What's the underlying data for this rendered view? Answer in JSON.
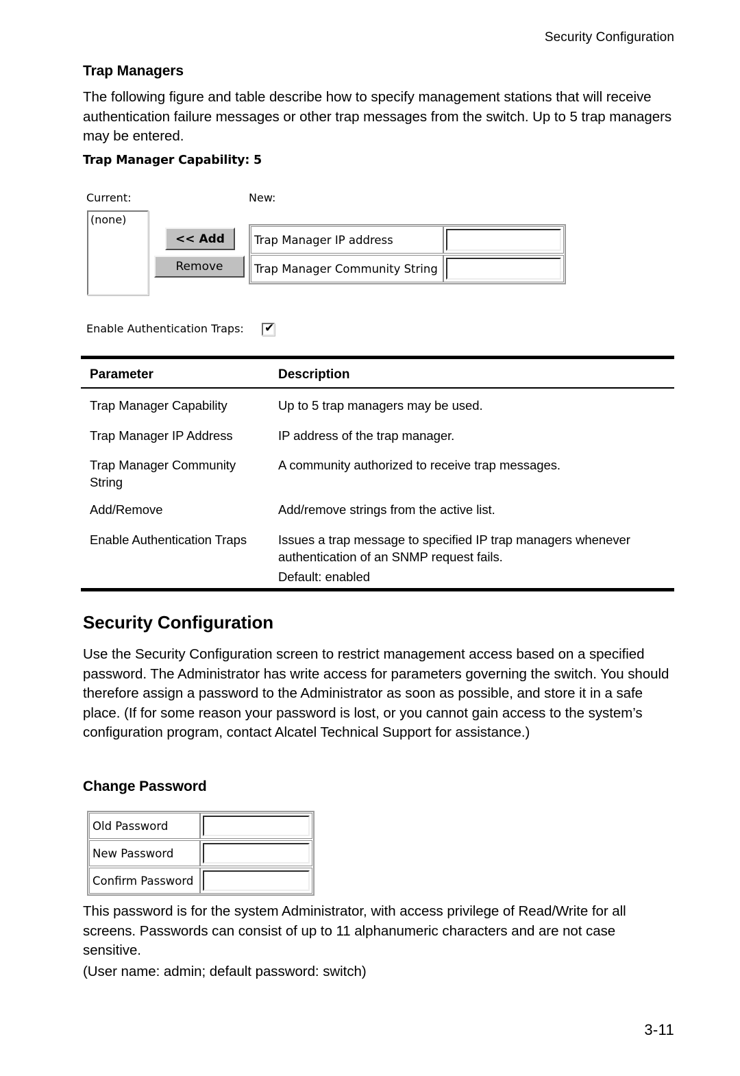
{
  "page": {
    "running_header": "Security Configuration",
    "folio": "3-11"
  },
  "trap_managers": {
    "heading": "Trap Managers",
    "intro": "The following figure and table describe how to specify management stations that will receive authentication failure messages or other trap messages from the switch. Up to 5 trap managers may be entered.",
    "screenshot": {
      "capability_line": "Trap Manager Capability: 5",
      "current_label": "Current:",
      "new_label": "New:",
      "current_list_item": "(none)",
      "add_button": "<< Add",
      "remove_button": "Remove",
      "fields": [
        {
          "label": "Trap Manager IP address",
          "value": "",
          "placeholder": ""
        },
        {
          "label": "Trap Manager Community String",
          "value": "",
          "placeholder": ""
        }
      ],
      "auth_traps_label": "Enable Authentication Traps:",
      "auth_traps_checked": true,
      "checkbox_glyph": "✔"
    },
    "table": {
      "headers": [
        "Parameter",
        "Description"
      ],
      "rows": [
        {
          "parameter": "Trap Manager Capability",
          "description": [
            "Up to 5 trap managers may be used."
          ]
        },
        {
          "parameter": "Trap Manager IP Address",
          "description": [
            "IP address of the trap manager."
          ]
        },
        {
          "parameter": "Trap Manager Community String",
          "description": [
            "A community authorized to receive trap messages."
          ]
        },
        {
          "parameter": "Add/Remove",
          "description": [
            "Add/remove strings from the active list."
          ]
        },
        {
          "parameter": "Enable Authentication Traps",
          "description": [
            "Issues a trap message to specified IP trap managers whenever authentication of an SNMP request fails.",
            "Default: enabled"
          ]
        }
      ]
    }
  },
  "security_configuration": {
    "heading": "Security Configuration",
    "intro": "Use the Security Configuration screen to restrict management access based on a specified password. The Administrator has write access for parameters governing the switch. You should therefore assign a password to the Administrator as soon as possible, and store it in a safe place. (If for some reason your password is lost, or you cannot gain access to the system’s configuration program, contact Alcatel Technical Support for assistance.)"
  },
  "change_password": {
    "heading": "Change Password",
    "fields": [
      {
        "label": "Old Password",
        "value": "",
        "placeholder": ""
      },
      {
        "label": "New Password",
        "value": "",
        "placeholder": ""
      },
      {
        "label": "Confirm Password",
        "value": "",
        "placeholder": ""
      }
    ],
    "note": "This password is for the system Administrator, with access privilege of Read/Write for all screens. Passwords can consist of up to 11 alphanumeric characters and are not case sensitive.",
    "credentials": "(User name: admin; default password: switch)"
  }
}
